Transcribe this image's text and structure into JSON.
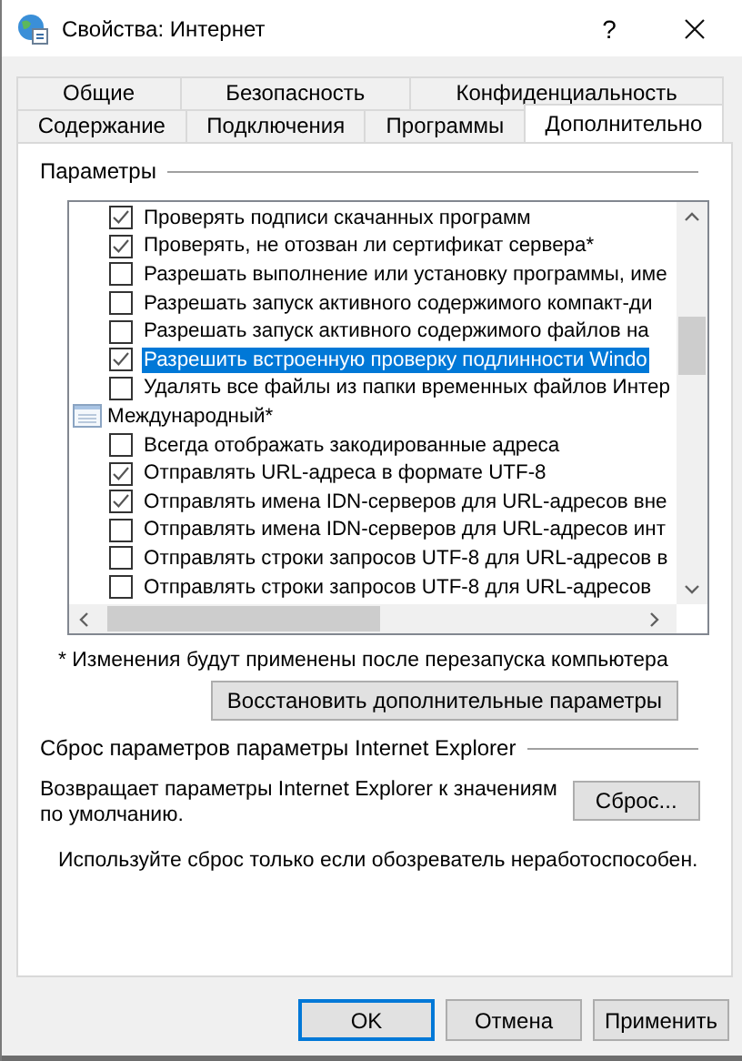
{
  "window": {
    "title": "Свойства: Интернет",
    "help": "?"
  },
  "tab_rows": [
    [
      {
        "label": "Общие",
        "selected": false
      },
      {
        "label": "Безопасность",
        "selected": false
      },
      {
        "label": "Конфиденциальность",
        "selected": false
      }
    ],
    [
      {
        "label": "Содержание",
        "selected": false
      },
      {
        "label": "Подключения",
        "selected": false
      },
      {
        "label": "Программы",
        "selected": false
      },
      {
        "label": "Дополнительно",
        "selected": true
      }
    ]
  ],
  "settings": {
    "title": "Параметры",
    "items": [
      {
        "kind": "checkbox",
        "label": "Проверять подписи скачанных программ",
        "checked": true,
        "selected": false
      },
      {
        "kind": "checkbox",
        "label": "Проверять, не отозван ли сертификат сервера*",
        "checked": true,
        "selected": false
      },
      {
        "kind": "checkbox",
        "label": "Разрешать выполнение или установку программы, име",
        "checked": false,
        "selected": false
      },
      {
        "kind": "checkbox",
        "label": "Разрешать запуск активного содержимого компакт-ди",
        "checked": false,
        "selected": false
      },
      {
        "kind": "checkbox",
        "label": "Разрешать запуск активного содержимого файлов на",
        "checked": false,
        "selected": false
      },
      {
        "kind": "checkbox",
        "label": "Разрешить встроенную проверку подлинности Windo",
        "checked": true,
        "selected": true
      },
      {
        "kind": "checkbox",
        "label": "Удалять все файлы из папки временных файлов Интер",
        "checked": false,
        "selected": false
      },
      {
        "kind": "group",
        "label": "Международный*",
        "children": [
          {
            "kind": "checkbox",
            "label": "Всегда отображать закодированные адреса",
            "checked": false,
            "selected": false
          },
          {
            "kind": "checkbox",
            "label": "Отправлять URL-адреса в формате UTF-8",
            "checked": true,
            "selected": false
          },
          {
            "kind": "checkbox",
            "label": "Отправлять имена IDN-серверов для URL-адресов вне",
            "checked": true,
            "selected": false
          },
          {
            "kind": "checkbox",
            "label": "Отправлять имена IDN-серверов для URL-адресов инт",
            "checked": false,
            "selected": false
          },
          {
            "kind": "checkbox",
            "label": "Отправлять строки запросов UTF-8 для URL-адресов в",
            "checked": false,
            "selected": false
          },
          {
            "kind": "checkbox",
            "label": "Отправлять строки запросов UTF-8 для URL-адресов",
            "checked": false,
            "selected": false
          }
        ]
      }
    ]
  },
  "footnote": "* Изменения будут применены после перезапуска компьютера",
  "restore_button": "Восстановить дополнительные параметры",
  "reset": {
    "title": "Сброс параметров параметры Internet Explorer",
    "description": "Возвращает параметры Internet Explorer к значениям по умолчанию.",
    "button": "Сброс...",
    "note": "Используйте сброс только если обозреватель неработоспособен."
  },
  "buttons": [
    {
      "label": "OK",
      "default": true
    },
    {
      "label": "Отмена",
      "default": false
    },
    {
      "label": "Применить",
      "default": false
    }
  ]
}
